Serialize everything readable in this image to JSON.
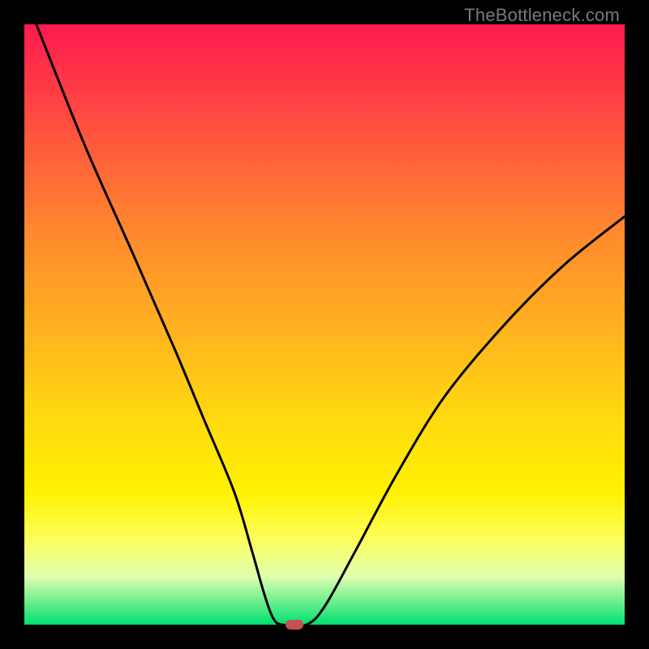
{
  "watermark": "TheBottleneck.com",
  "chart_data": {
    "type": "line",
    "title": "",
    "xlabel": "",
    "ylabel": "",
    "xlim": [
      0,
      100
    ],
    "ylim": [
      0,
      100
    ],
    "grid": false,
    "legend": false,
    "series": [
      {
        "name": "curve",
        "x": [
          2,
          10,
          18,
          25,
          30,
          35,
          38,
          40,
          41.5,
          43,
          47,
          50,
          55,
          62,
          70,
          80,
          90,
          100
        ],
        "values": [
          100,
          80,
          62,
          46,
          34,
          22,
          12,
          5,
          1,
          0,
          0,
          3,
          12,
          25,
          38,
          50,
          60,
          68
        ]
      }
    ],
    "marker": {
      "x": 45,
      "y": 0,
      "color": "#c75050"
    },
    "background_gradient": {
      "top": "#ff1a4d",
      "mid": "#ffe700",
      "bottom": "#00e070"
    }
  }
}
